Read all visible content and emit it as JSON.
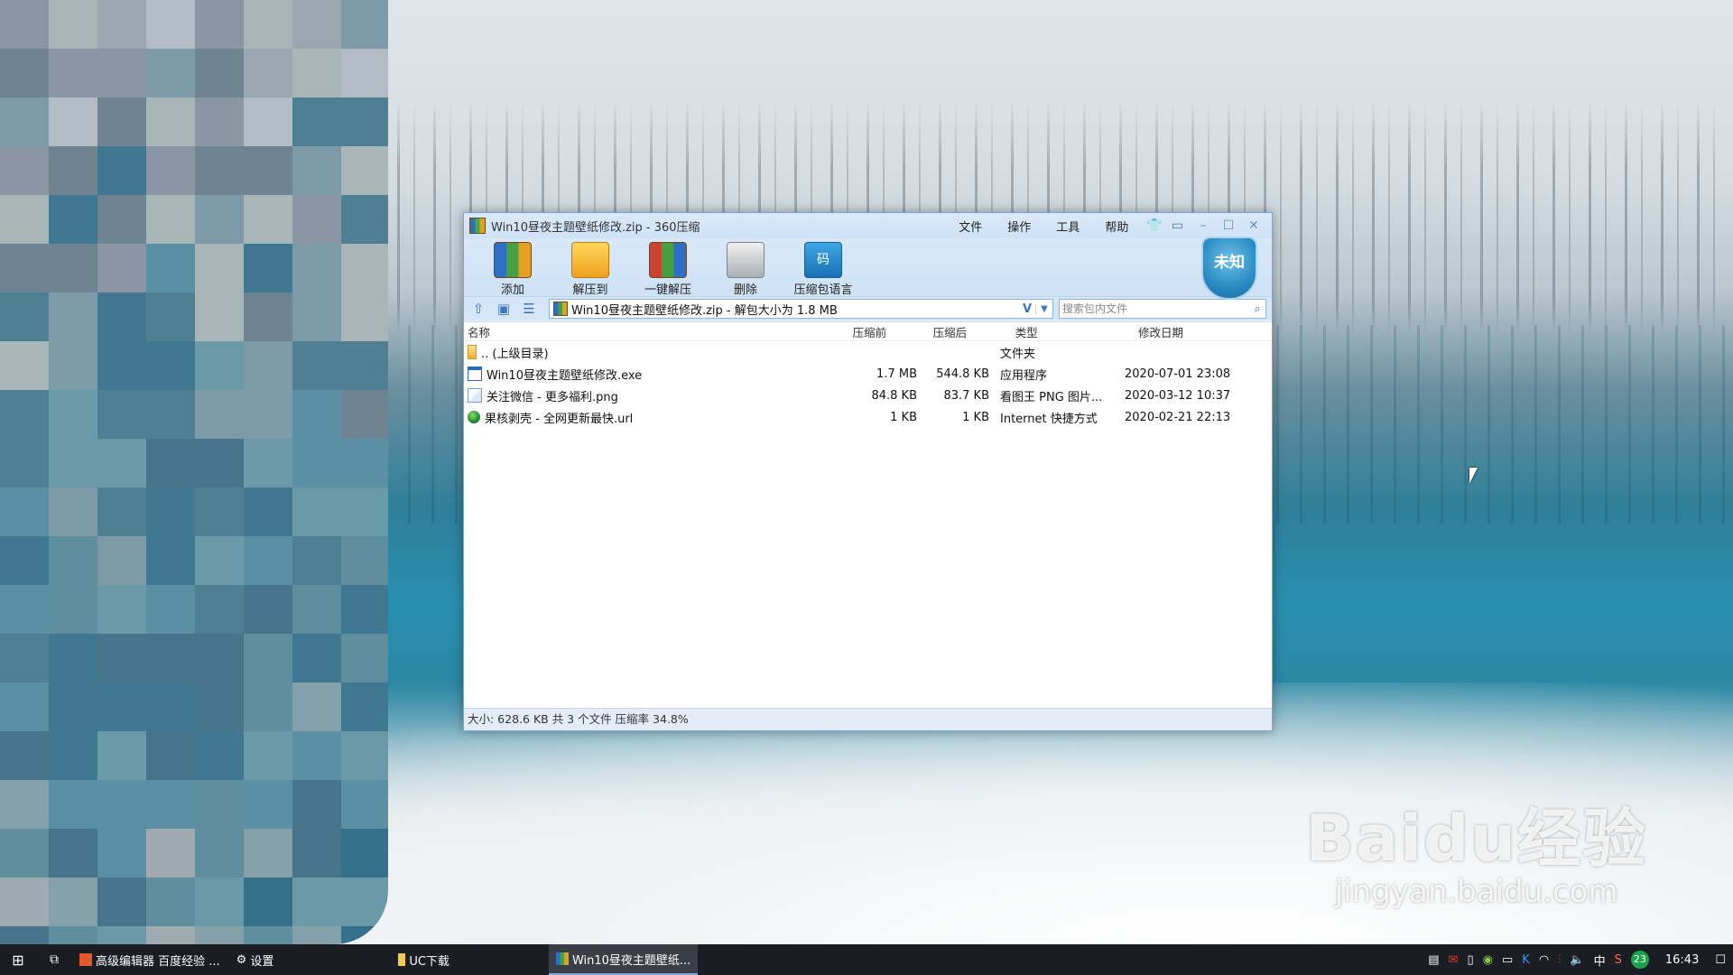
{
  "window": {
    "title": "Win10昼夜主题壁纸修改.zip - 360压缩",
    "menu": [
      "文件",
      "操作",
      "工具",
      "帮助"
    ]
  },
  "toolbar": {
    "add": "添加",
    "extract_to": "解压到",
    "one_click_extract": "一键解压",
    "delete": "删除",
    "archive_language": "压缩包语言",
    "shield_label": "未知",
    "code_icon_text": "码"
  },
  "address": {
    "path": "Win10昼夜主题壁纸修改.zip - 解包大小为 1.8 MB",
    "search_placeholder": "搜索包内文件"
  },
  "columns": {
    "name": "名称",
    "before": "压缩前",
    "after": "压缩后",
    "type": "类型",
    "date": "修改日期"
  },
  "files": [
    {
      "name": ".. (上级目录)",
      "before": "",
      "after": "",
      "type": "文件夹",
      "date": ""
    },
    {
      "name": "Win10昼夜主题壁纸修改.exe",
      "before": "1.7 MB",
      "after": "544.8 KB",
      "type": "应用程序",
      "date": "2020-07-01 23:08"
    },
    {
      "name": "关注微信 - 更多福利.png",
      "before": "84.8 KB",
      "after": "83.7 KB",
      "type": "看图王 PNG 图片...",
      "date": "2020-03-12 10:37"
    },
    {
      "name": "果核剥壳 - 全网更新最快.url",
      "before": "1 KB",
      "after": "1 KB",
      "type": "Internet 快捷方式",
      "date": "2020-02-21 22:13"
    }
  ],
  "status": "大小: 628.6 KB 共 3 个文件 压缩率 34.8%",
  "taskbar": {
    "apps": [
      "高级编辑器 百度经验 ...",
      "设置",
      "UC下载",
      "Win10昼夜主题壁纸..."
    ],
    "ime": "中",
    "badge": "23",
    "clock": "16:43"
  },
  "watermark": {
    "logo": "Baidu经验",
    "url": "jingyan.baidu.com"
  },
  "colors": {
    "window_bg": "#e9f1fb",
    "accent": "#2d73c0",
    "taskbar": "#1a1e24"
  }
}
